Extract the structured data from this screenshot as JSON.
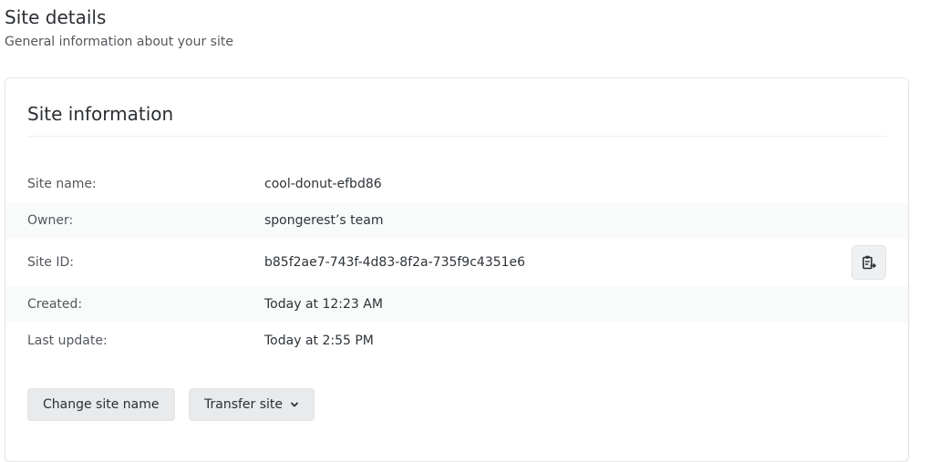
{
  "header": {
    "title": "Site details",
    "subtitle": "General information about your site"
  },
  "card": {
    "title": "Site information",
    "rows": [
      {
        "label": "Site name:",
        "value": "cool-donut-efbd86"
      },
      {
        "label": "Owner:",
        "value": "spongerest’s team"
      },
      {
        "label": "Site ID:",
        "value": "b85f2ae7-743f-4d83-8f2a-735f9c4351e6"
      },
      {
        "label": "Created:",
        "value": "Today at 12:23 AM"
      },
      {
        "label": "Last update:",
        "value": "Today at 2:55 PM"
      }
    ],
    "copy_icon": "clipboard-copy-icon"
  },
  "actions": {
    "change_name_label": "Change site name",
    "transfer_label": "Transfer site",
    "transfer_icon": "chevron-down-icon"
  }
}
